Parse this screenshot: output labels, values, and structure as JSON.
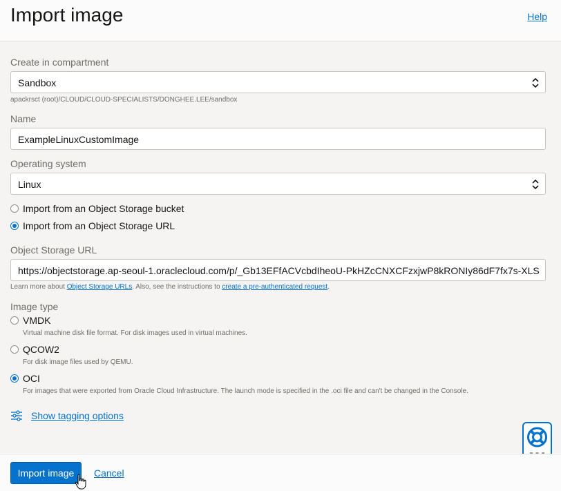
{
  "header": {
    "title": "Import image",
    "help": "Help"
  },
  "compartment": {
    "label": "Create in compartment",
    "value": "Sandbox",
    "path": "apackrsct (root)/CLOUD/CLOUD-SPECIALISTS/DONGHEE.LEE/sandbox"
  },
  "name": {
    "label": "Name",
    "value": "ExampleLinuxCustomImage"
  },
  "os": {
    "label": "Operating system",
    "value": "Linux"
  },
  "source": {
    "options": [
      {
        "label": "Import from an Object Storage bucket",
        "selected": false
      },
      {
        "label": "Import from an Object Storage URL",
        "selected": true
      }
    ]
  },
  "url": {
    "label": "Object Storage URL",
    "value": "https://objectstorage.ap-seoul-1.oraclecloud.com/p/_Gb13EFfACVcbdIheoU-PkHZcCNXCFzxjwP8kRONIy86dF7fx7s-XLS",
    "help_prefix": "Learn more about ",
    "help_link1": "Object Storage URLs",
    "help_mid": ". Also, see the instructions to ",
    "help_link2": "create a pre-authenticated request",
    "help_suffix": "."
  },
  "image_type": {
    "label": "Image type",
    "options": [
      {
        "label": "VMDK",
        "desc": "Virtual machine disk file format. For disk images used in virtual machines.",
        "selected": false
      },
      {
        "label": "QCOW2",
        "desc": "For disk image files used by QEMU.",
        "selected": false
      },
      {
        "label": "OCI",
        "desc": "For images that were exported from Oracle Cloud Infrastructure. The launch mode is specified in the .oci file and can't be changed in the Console.",
        "selected": true
      }
    ]
  },
  "tagging": {
    "label": "Show tagging options",
    "icon": "sliders-icon"
  },
  "footer": {
    "primary": "Import image",
    "cancel": "Cancel"
  },
  "colors": {
    "accent": "#0572ce",
    "content_bg": "#f5f4f2"
  }
}
